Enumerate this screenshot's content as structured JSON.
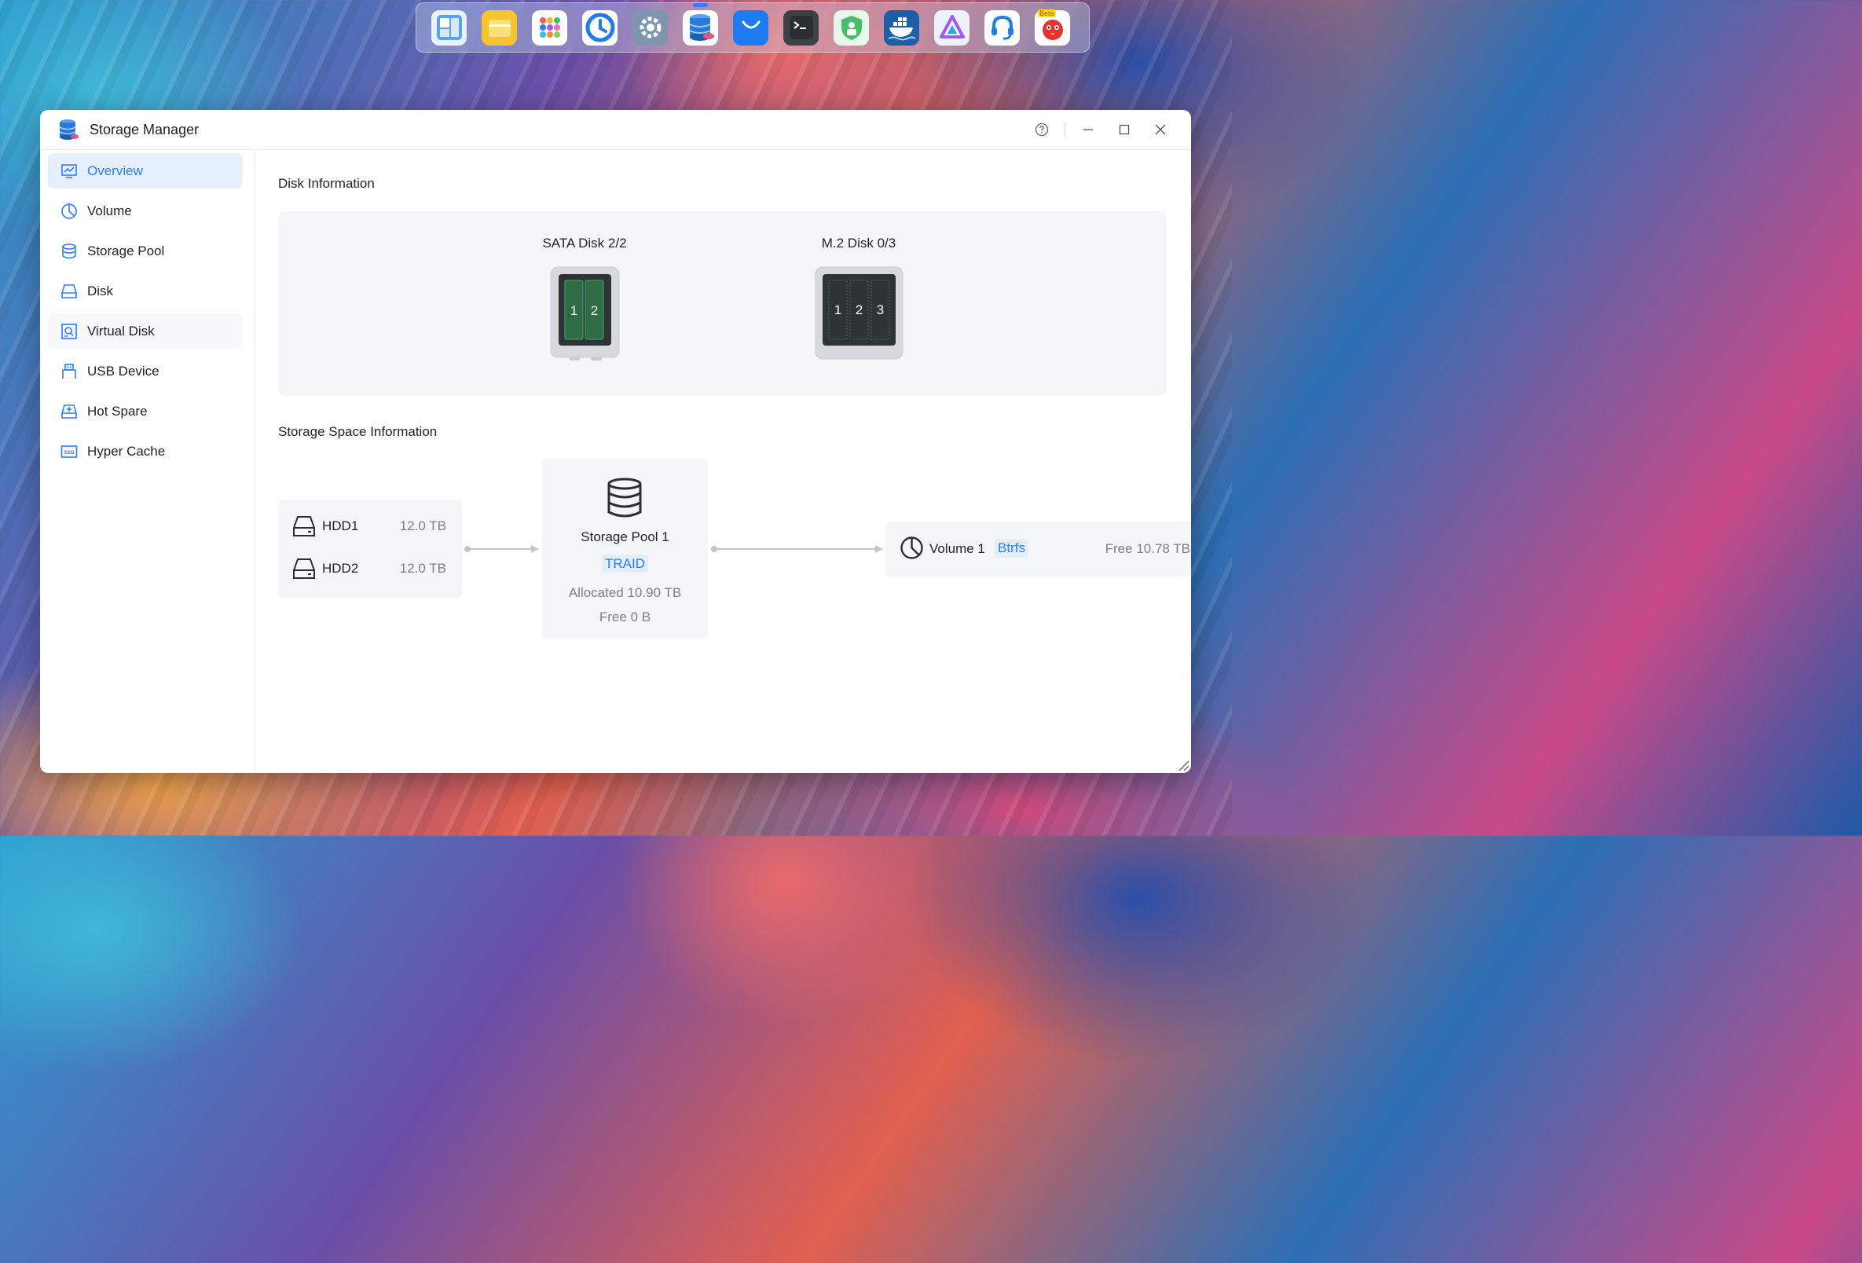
{
  "dock": {
    "apps": [
      {
        "name": "app-center-icon",
        "color": "#4a90e2"
      },
      {
        "name": "files-icon",
        "color": "#f6c431"
      },
      {
        "name": "all-apps-icon",
        "color": "#ffffff"
      },
      {
        "name": "backup-clock-icon",
        "color": "#1e7ee8"
      },
      {
        "name": "settings-icon",
        "color": "#6f8aa6"
      },
      {
        "name": "storage-manager-icon",
        "color": "#2a7bd8",
        "running": true
      },
      {
        "name": "app-store-icon",
        "color": "#1d7cf2"
      },
      {
        "name": "terminal-icon",
        "color": "#2d3134"
      },
      {
        "name": "security-shield-icon",
        "color": "#46c068"
      },
      {
        "name": "docker-icon",
        "color": "#1c5fa8"
      },
      {
        "name": "jellyfin-icon",
        "color": "#e8ecf6"
      },
      {
        "name": "support-headset-icon",
        "color": "#ffffff"
      },
      {
        "name": "mascot-beta-icon",
        "color": "#ffffff",
        "badge": "Beta"
      }
    ]
  },
  "window": {
    "title": "Storage Manager"
  },
  "sidebar": {
    "items": [
      {
        "label": "Overview",
        "icon": "overview-monitor-icon",
        "active": true
      },
      {
        "label": "Volume",
        "icon": "volume-pie-icon"
      },
      {
        "label": "Storage Pool",
        "icon": "storage-pool-database-icon"
      },
      {
        "label": "Disk",
        "icon": "disk-drive-icon"
      },
      {
        "label": "Virtual Disk",
        "icon": "virtual-disk-icon"
      },
      {
        "label": "USB Device",
        "icon": "usb-icon"
      },
      {
        "label": "Hot Spare",
        "icon": "hot-spare-icon"
      },
      {
        "label": "Hyper Cache",
        "icon": "ssd-cache-icon"
      }
    ]
  },
  "disk_info": {
    "title": "Disk Information",
    "sata": {
      "label": "SATA Disk 2/2",
      "slots": [
        "1",
        "2"
      ]
    },
    "m2": {
      "label": "M.2 Disk 0/3",
      "slots": [
        "1",
        "2",
        "3"
      ]
    }
  },
  "storage_space": {
    "title": "Storage Space Information",
    "disks": [
      {
        "name": "HDD1",
        "size": "12.0 TB"
      },
      {
        "name": "HDD2",
        "size": "12.0 TB"
      }
    ],
    "pool": {
      "name": "Storage Pool 1",
      "raid": "TRAID",
      "allocated": "Allocated 10.90 TB",
      "free": "Free 0 B"
    },
    "volume": {
      "name": "Volume 1",
      "fs": "Btrfs",
      "free": "Free 10.78 TB"
    }
  },
  "colors": {
    "accent": "#2f7cf6",
    "active_bg": "#e6f0fc",
    "panel_bg": "#f5f6f8",
    "disk_green": "#2f6b45"
  }
}
